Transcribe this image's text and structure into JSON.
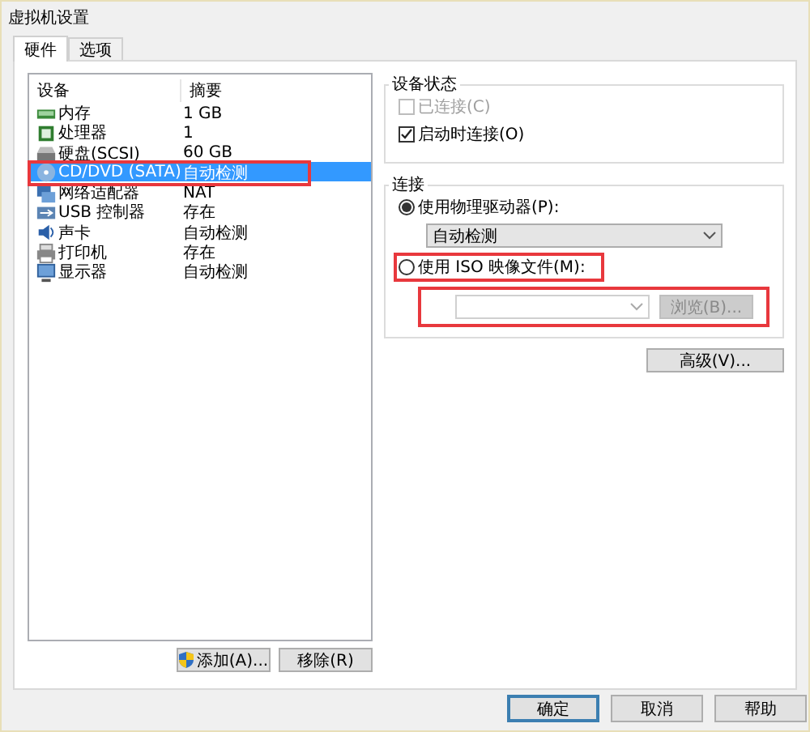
{
  "window": {
    "title": "虚拟机设置"
  },
  "tabs": [
    {
      "label": "硬件",
      "selected": true
    },
    {
      "label": "选项",
      "selected": false
    }
  ],
  "device_list": {
    "columns": [
      "设备",
      "摘要"
    ],
    "rows": [
      {
        "kind": "memory",
        "name": "内存",
        "summary": "1 GB",
        "selected": false
      },
      {
        "kind": "cpu",
        "name": "处理器",
        "summary": "1",
        "selected": false
      },
      {
        "kind": "disk",
        "name": "硬盘(SCSI)",
        "summary": "60 GB",
        "selected": false
      },
      {
        "kind": "cd",
        "name": "CD/DVD (SATA)",
        "summary": "自动检测",
        "selected": true
      },
      {
        "kind": "network",
        "name": "网络适配器",
        "summary": "NAT",
        "selected": false
      },
      {
        "kind": "usb",
        "name": "USB 控制器",
        "summary": "存在",
        "selected": false
      },
      {
        "kind": "sound",
        "name": "声卡",
        "summary": "自动检测",
        "selected": false
      },
      {
        "kind": "printer",
        "name": "打印机",
        "summary": "存在",
        "selected": false
      },
      {
        "kind": "display",
        "name": "显示器",
        "summary": "自动检测",
        "selected": false
      }
    ]
  },
  "device_status": {
    "title": "设备状态",
    "checkboxes": [
      {
        "label": "已连接(C)",
        "checked": false,
        "disabled": true
      },
      {
        "label": "启动时连接(O)",
        "checked": true,
        "disabled": false
      }
    ]
  },
  "connection": {
    "title": "连接",
    "physical": {
      "label": "使用物理驱动器(P):",
      "selected": true,
      "value": "自动检测"
    },
    "iso": {
      "label": "使用 ISO 映像文件(M):",
      "selected": false,
      "browse": "浏览(B)..."
    }
  },
  "advanced_button": "高级(V)...",
  "add_button": "添加(A)...",
  "remove_button": "移除(R)",
  "buttons": [
    {
      "label": "确定",
      "default": true
    },
    {
      "label": "取消",
      "default": false
    },
    {
      "label": "帮助",
      "default": false
    }
  ]
}
